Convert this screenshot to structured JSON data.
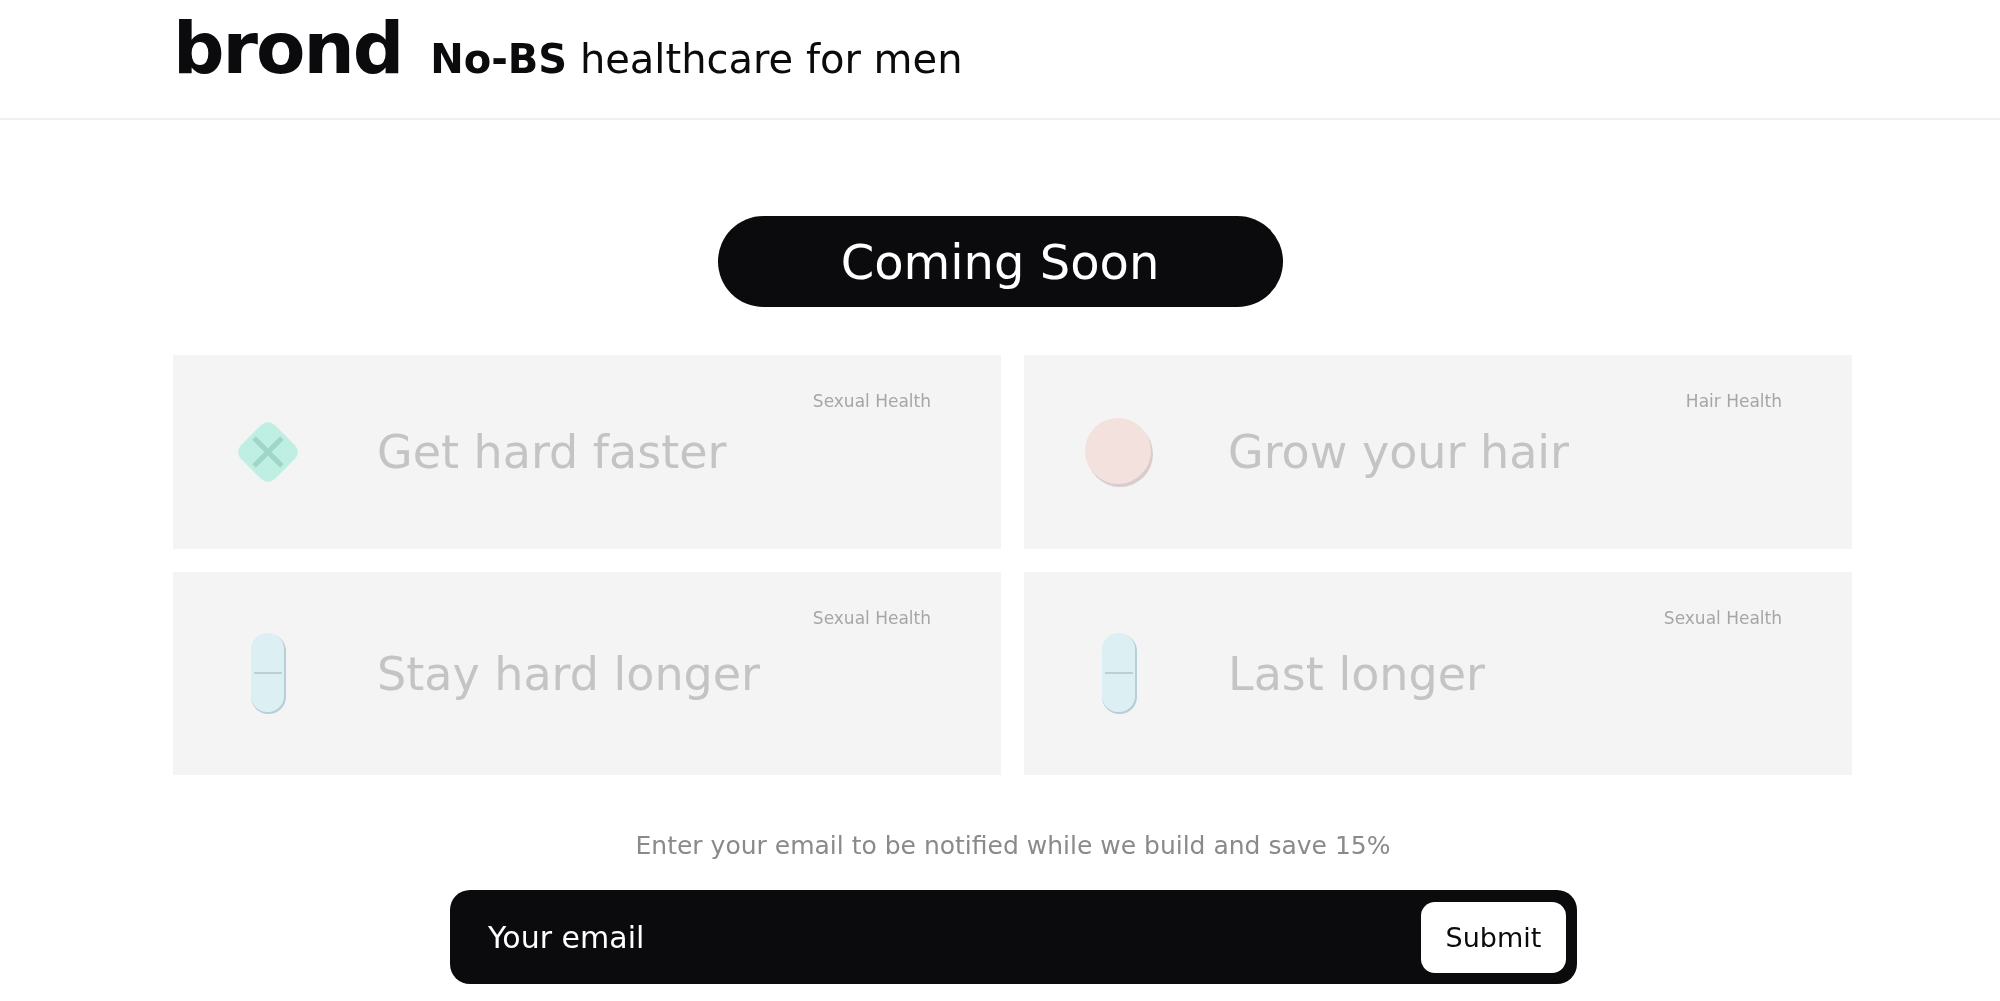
{
  "header": {
    "logo": "brond",
    "tagline": "**No-BS** healthcare for men"
  },
  "banner": {
    "label": "Coming Soon"
  },
  "products": [
    {
      "category": "Sexual Health",
      "title": "Get hard faster",
      "kind": "diamond"
    },
    {
      "category": "Hair Health",
      "title": "Grow your hair",
      "kind": "round"
    },
    {
      "category": "Sexual Health",
      "title": "Stay hard longer",
      "kind": "capsule"
    },
    {
      "category": "Sexual Health",
      "title": "Last longer",
      "kind": "capsule"
    }
  ],
  "signup": {
    "prompt": "Enter your email to be notified while we build and save 15%",
    "placeholder": "Your email",
    "button": "Submit"
  }
}
